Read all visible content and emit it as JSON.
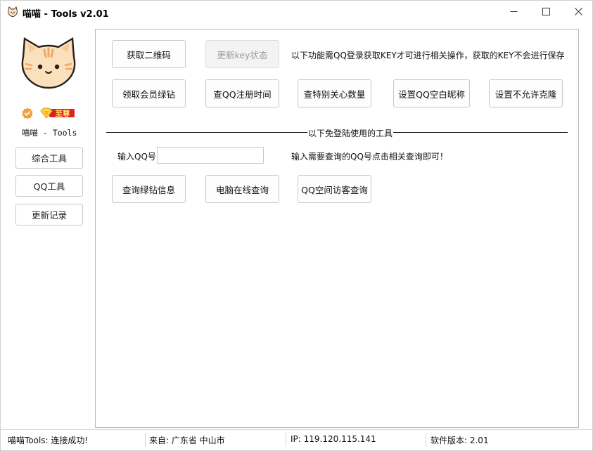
{
  "window": {
    "title": "喵喵 - Tools v2.01",
    "controls": {
      "minimize": "—",
      "maximize": "☐",
      "close": "✕"
    }
  },
  "sidebar": {
    "name": "喵喵 - Tools",
    "badges": {
      "verified_icon": "verified-shield-icon",
      "vip_label": "至尊"
    },
    "nav": [
      {
        "label": "综合工具"
      },
      {
        "label": "QQ工具"
      },
      {
        "label": "更新记录"
      }
    ]
  },
  "main": {
    "top_buttons": [
      {
        "label": "获取二维码",
        "enabled": true
      },
      {
        "label": "更新key状态",
        "enabled": false
      }
    ],
    "top_note": "以下功能需QQ登录获取KEY才可进行相关操作，获取的KEY不会进行保存",
    "feature_buttons": [
      {
        "label": "领取会员绿钻"
      },
      {
        "label": "查QQ注册时间"
      },
      {
        "label": "查特别关心数量"
      },
      {
        "label": "设置QQ空白昵称"
      },
      {
        "label": "设置不允许克隆"
      }
    ],
    "divider_label": "以下免登陆使用的工具",
    "qq_input": {
      "label": "输入QQ号:",
      "value": "",
      "placeholder": ""
    },
    "qq_note": "输入需要查询的QQ号点击相关查询即可！",
    "query_buttons": [
      {
        "label": "查询绿钻信息"
      },
      {
        "label": "电脑在线查询"
      },
      {
        "label": "QQ空间访客查询"
      }
    ]
  },
  "statusbar": {
    "connection": "喵喵Tools: 连接成功!",
    "location": "来自: 广东省 中山市",
    "ip": "IP: 119.120.115.141",
    "version": "软件版本: 2.01"
  },
  "colors": {
    "accent_orange": "#f0a040",
    "vip_red": "#e02020",
    "vip_gold": "#ffd84a",
    "border": "#c8c8c8"
  }
}
